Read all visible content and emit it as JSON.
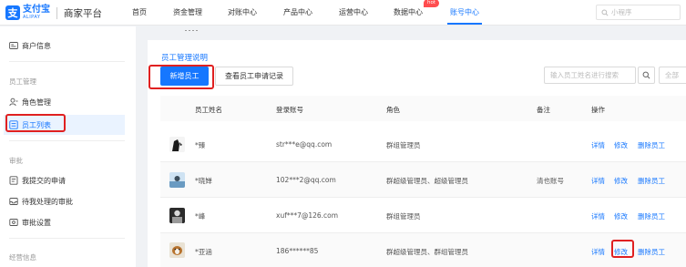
{
  "header": {
    "logo_mark": "支",
    "logo_cn": "支付宝",
    "logo_en": "ALIPAY",
    "platform": "商家平台",
    "nav": [
      "首页",
      "资金管理",
      "对账中心",
      "产品中心",
      "运营中心",
      "数据中心",
      "账号中心"
    ],
    "nav_active": "账号中心",
    "hot_badge": "hot",
    "search_placeholder": "小程序"
  },
  "sidebar": {
    "merchant_info": "商户信息",
    "group_staff": "员工管理",
    "role_mgmt": "角色管理",
    "staff_list": "员工列表",
    "group_approval": "审批",
    "my_submitted": "我提交的申请",
    "pending_approval": "待我处理的审批",
    "approval_settings": "审批设置",
    "group_business": "经营信息"
  },
  "main": {
    "title": "员工管理说明",
    "add_button": "新增员工",
    "record_button": "查看员工申请记录",
    "search_placeholder": "输入员工姓名进行搜索",
    "filter_label": "全部"
  },
  "table": {
    "columns": {
      "name": "员工姓名",
      "account": "登录账号",
      "role": "角色",
      "remark": "备注",
      "actions": "操作"
    },
    "rows": [
      {
        "name": "*臻",
        "account": "str***e@qq.com",
        "role": "群组管理员",
        "remark": ""
      },
      {
        "name": "*晓婵",
        "account": "102***2@qq.com",
        "role": "群超级管理员、超级管理员",
        "remark": "清也账号"
      },
      {
        "name": "*峰",
        "account": "xuf***7@126.com",
        "role": "群组管理员",
        "remark": ""
      },
      {
        "name": "*亚涵",
        "account": "186******85",
        "role": "群超级管理员、群组管理员",
        "remark": ""
      }
    ],
    "action_labels": {
      "detail": "详情",
      "edit": "修改",
      "delete": "删除员工"
    }
  },
  "colors": {
    "accent": "#1677ff",
    "highlight_box": "#e02020",
    "hot": "#ff4d4f"
  }
}
